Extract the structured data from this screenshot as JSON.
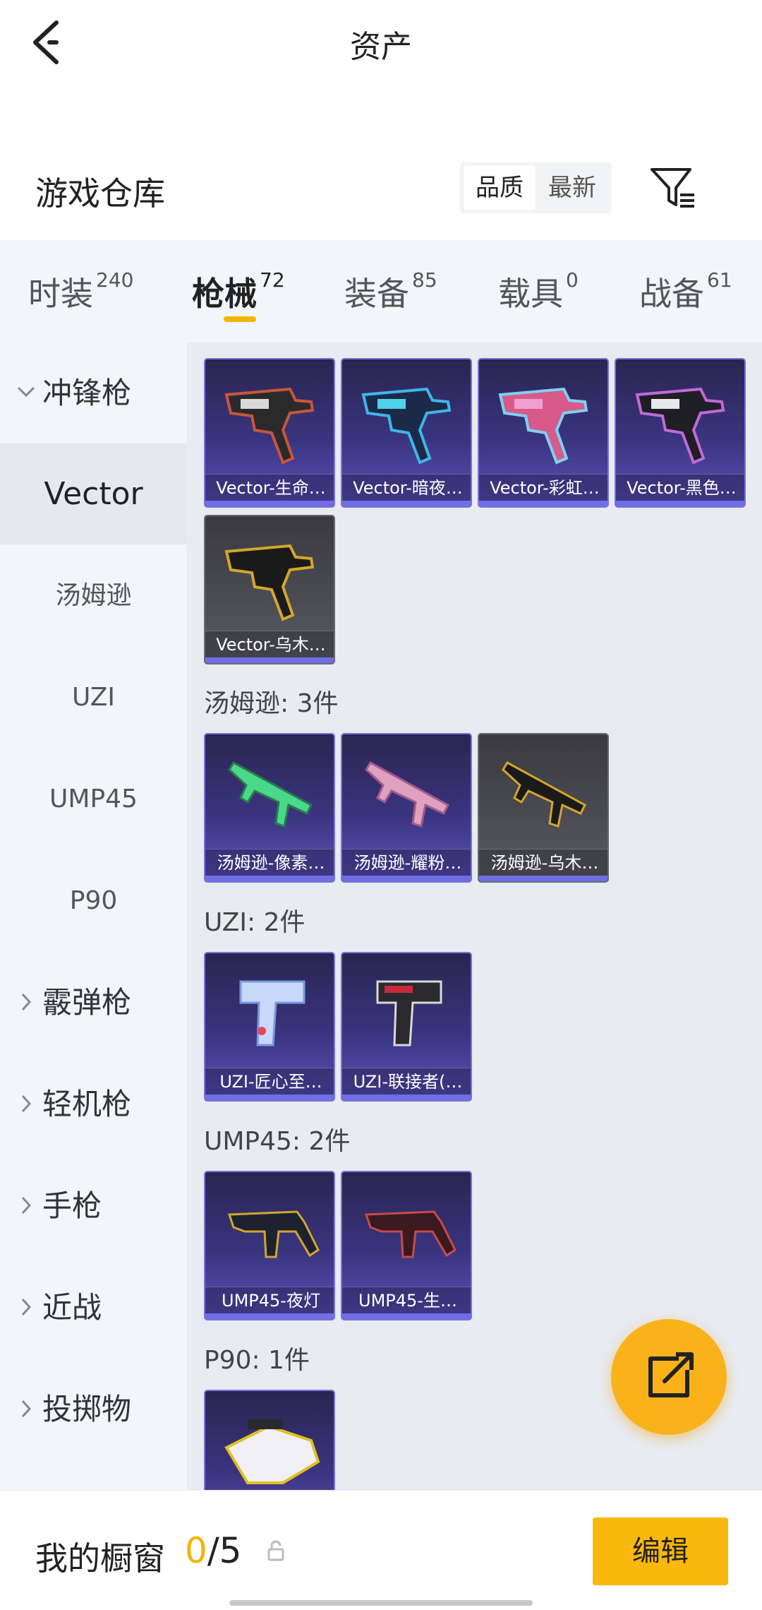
{
  "header": {
    "title": "资产",
    "back_icon": "chevron-left-icon"
  },
  "warehouse": {
    "title": "游戏仓库",
    "sort_options": [
      "品质",
      "最新"
    ],
    "selected_sort": "品质",
    "filter_icon": "filter-icon"
  },
  "tabs": [
    {
      "label": "时装",
      "count": "240"
    },
    {
      "label": "枪械",
      "count": "72",
      "active": true
    },
    {
      "label": "装备",
      "count": "85"
    },
    {
      "label": "载具",
      "count": "0"
    },
    {
      "label": "战备",
      "count": "61"
    }
  ],
  "sidebar": {
    "items": [
      {
        "label": "冲锋枪",
        "type": "group",
        "expanded": true
      },
      {
        "label": "Vector",
        "type": "sub",
        "selected": true
      },
      {
        "label": "汤姆逊",
        "type": "sub"
      },
      {
        "label": "UZI",
        "type": "sub"
      },
      {
        "label": "UMP45",
        "type": "sub"
      },
      {
        "label": "P90",
        "type": "sub"
      },
      {
        "label": "霰弹枪",
        "type": "group"
      },
      {
        "label": "轻机枪",
        "type": "group"
      },
      {
        "label": "手枪",
        "type": "group"
      },
      {
        "label": "近战",
        "type": "group"
      },
      {
        "label": "投掷物",
        "type": "group"
      }
    ]
  },
  "sections": [
    {
      "title": "",
      "items": [
        "Vector-生命…",
        "Vector-暗夜…",
        "Vector-彩虹…",
        "Vector-黑色…",
        "Vector-乌木…"
      ]
    },
    {
      "title": "汤姆逊: 3件",
      "items": [
        "汤姆逊-像素…",
        "汤姆逊-耀粉…",
        "汤姆逊-乌木…"
      ]
    },
    {
      "title": "UZI: 2件",
      "items": [
        "UZI-匠心至…",
        "UZI-联接者(…"
      ]
    },
    {
      "title": "UMP45: 2件",
      "items": [
        "UMP45-夜灯",
        "UMP45-生…"
      ]
    },
    {
      "title": "P90: 1件",
      "items": [
        ""
      ]
    }
  ],
  "fab": {
    "icon": "share-icon"
  },
  "bottom": {
    "label": "我的橱窗",
    "current": "0",
    "total": "/5",
    "lock_icon": "lock-icon",
    "edit_label": "编辑"
  },
  "colors": {
    "accent": "#f4b400",
    "card_purple": "#3a3480",
    "card_gray": "#4a4a52"
  }
}
